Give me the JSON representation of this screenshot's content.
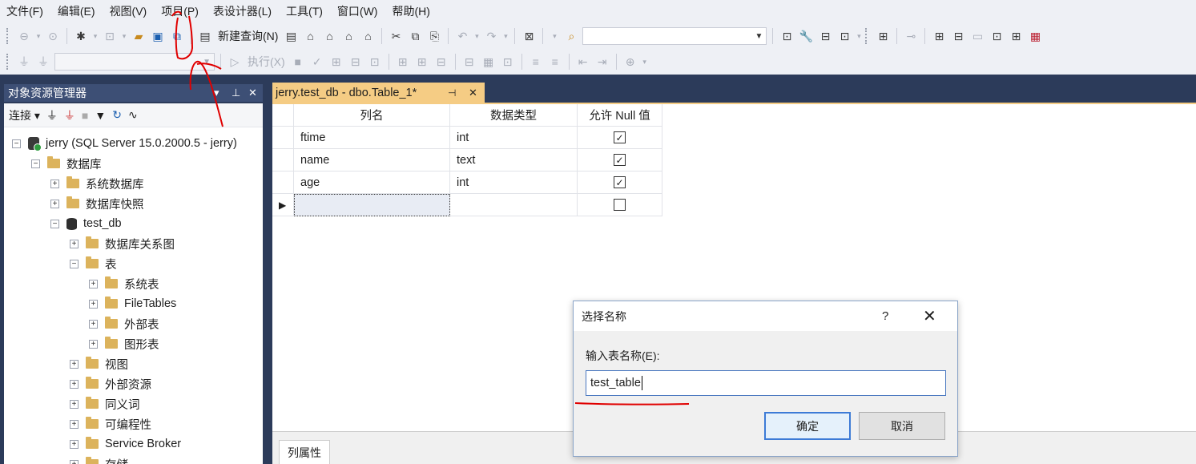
{
  "menu": [
    "文件(F)",
    "编辑(E)",
    "视图(V)",
    "项目(P)",
    "表设计器(L)",
    "工具(T)",
    "窗口(W)",
    "帮助(H)"
  ],
  "toolbar1": {
    "new_query": "新建查询(N)"
  },
  "toolbar2": {
    "execute": "执行(X)"
  },
  "object_explorer": {
    "title": "对象资源管理器",
    "connect": "连接",
    "tree": [
      {
        "label": "jerry (SQL Server 15.0.2000.5 - jerry)",
        "expander": "⊟"
      },
      {
        "label": "数据库",
        "expander": "⊟"
      },
      {
        "label": "系统数据库",
        "expander": "⊞"
      },
      {
        "label": "数据库快照",
        "expander": "⊞"
      },
      {
        "label": "test_db",
        "expander": "⊟"
      },
      {
        "label": "数据库关系图",
        "expander": "⊞"
      },
      {
        "label": "表",
        "expander": "⊟"
      },
      {
        "label": "系统表",
        "expander": "⊞"
      },
      {
        "label": "FileTables",
        "expander": "⊞"
      },
      {
        "label": "外部表",
        "expander": "⊞"
      },
      {
        "label": "图形表",
        "expander": "⊞"
      },
      {
        "label": "视图",
        "expander": "⊞"
      },
      {
        "label": "外部资源",
        "expander": "⊞"
      },
      {
        "label": "同义词",
        "expander": "⊞"
      },
      {
        "label": "可编程性",
        "expander": "⊞"
      },
      {
        "label": "Service Broker",
        "expander": "⊞"
      },
      {
        "label": "存储",
        "expander": "⊞"
      }
    ]
  },
  "doc_tab": {
    "title": "jerry.test_db - dbo.Table_1*"
  },
  "table_designer": {
    "headers": [
      "列名",
      "数据类型",
      "允许 Null 值"
    ],
    "rows": [
      {
        "name": "ftime",
        "type": "int",
        "nullable": true
      },
      {
        "name": "name",
        "type": "text",
        "nullable": true
      },
      {
        "name": "age",
        "type": "int",
        "nullable": true
      },
      {
        "name": "",
        "type": "",
        "nullable": false
      }
    ],
    "checked_mark": "✓"
  },
  "properties_tab": "列属性",
  "dialog": {
    "title": "选择名称",
    "help": "?",
    "close": "✕",
    "label": "输入表名称(E):",
    "value": "test_table",
    "ok": "确定",
    "cancel": "取消"
  },
  "colors": {
    "frame": "#2c3b5a",
    "active_tab": "#f5cc84",
    "annotation": "#e00000"
  }
}
